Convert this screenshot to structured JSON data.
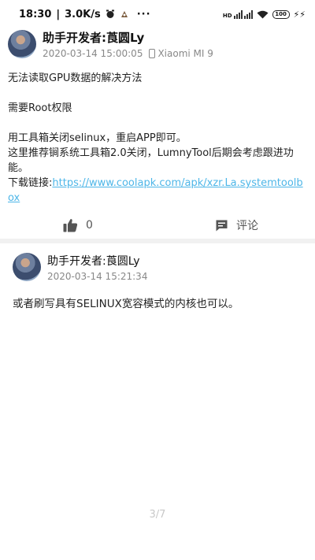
{
  "status_bar": {
    "time": "18:30",
    "net_speed": "3.0K/s",
    "more": "···",
    "hd_label": "HD",
    "battery": "100",
    "charge_glyph": "⚡⚡"
  },
  "post": {
    "author": "助手开发者:莨圆Ly",
    "date": "2020-03-14 15:00:05",
    "device": "Xiaomi MI 9",
    "lines": [
      "无法读取GPU数据的解决方法",
      "需要Root权限",
      "用工具箱关闭selinux，重启APP即可。",
      "这里推荐锏系统工具箱2.0关闭，LumnyTool后期会考虑跟进功能。"
    ],
    "download_label": "下载链接:",
    "download_url": "https://www.coolapk.com/apk/xzr.La.systemtoolbox",
    "likes": "0",
    "comment_label": "评论"
  },
  "reply": {
    "author": "助手开发者:莨圆Ly",
    "date": "2020-03-14 15:21:34",
    "text": "或者刷写具有SELINUX宽容模式的内核也可以。"
  },
  "pager": {
    "label": "3/7"
  },
  "colors": {
    "link": "#4db6e8",
    "muted": "#888888",
    "divider": "#f1f1f1"
  },
  "icons": [
    "alarm-icon",
    "cell-signal-icon",
    "wifi-icon",
    "battery-icon",
    "phone-icon",
    "thumbs-up-icon",
    "comment-icon"
  ]
}
